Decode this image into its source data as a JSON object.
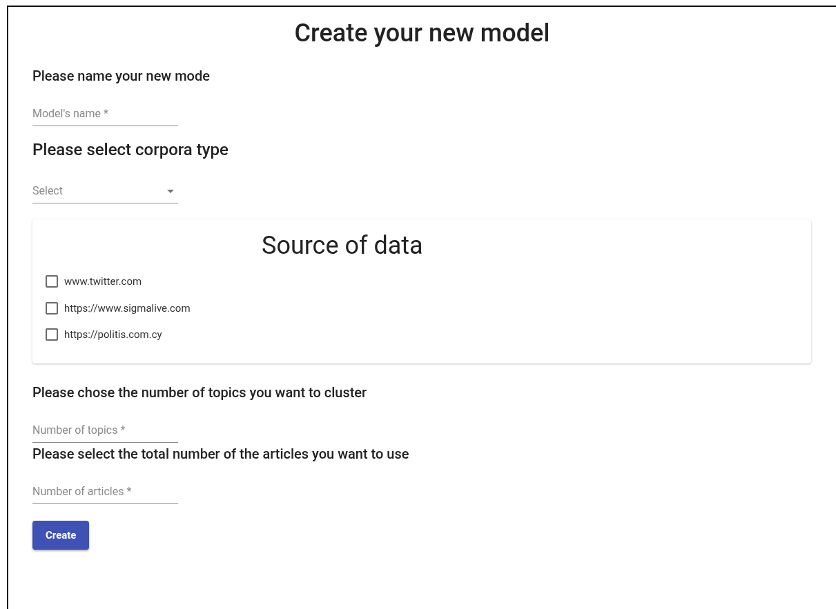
{
  "title": "Create your new model",
  "sections": [
    {
      "kind": "text",
      "heading": "Please name your new mode",
      "placeholder": "Model's name *"
    },
    {
      "kind": "select",
      "heading": "Please select corpora type",
      "placeholder": "Select"
    },
    {
      "kind": "checklist",
      "heading": "Source of data",
      "options": [
        {
          "label": "www.twitter.com",
          "checked": false
        },
        {
          "label": "https://www.sigmalive.com",
          "checked": false
        },
        {
          "label": "https://politis.com.cy",
          "checked": false
        }
      ]
    },
    {
      "kind": "text",
      "heading": "Please chose the number of topics you want to cluster",
      "placeholder": "Number of topics *"
    },
    {
      "kind": "text",
      "heading": "Please select the total number of the articles you want to use",
      "placeholder": "Number of articles *"
    }
  ],
  "button": "Create"
}
